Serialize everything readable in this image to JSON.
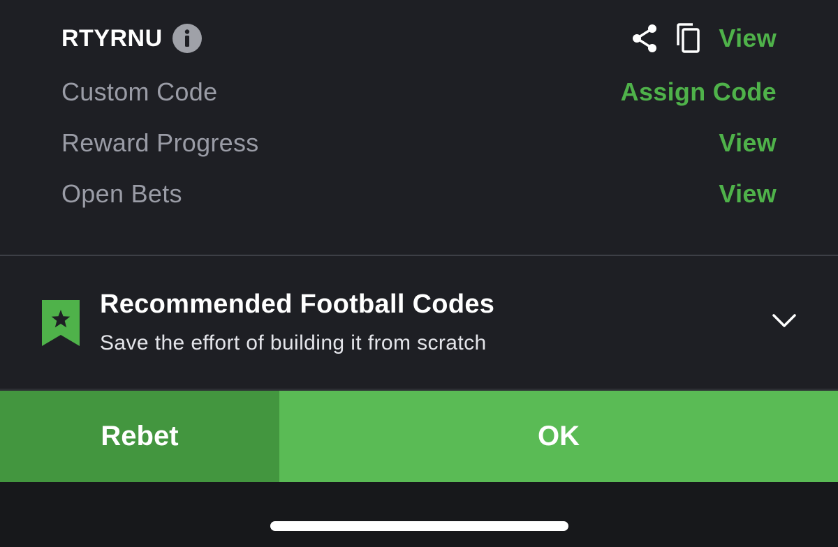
{
  "code_section": {
    "code": "RTYRNU",
    "info_icon": "info-icon",
    "share_icon": "share-icon",
    "copy_icon": "copy-icon",
    "view_label": "View"
  },
  "rows": [
    {
      "label": "Custom Code",
      "action": "Assign Code"
    },
    {
      "label": "Reward Progress",
      "action": "View"
    },
    {
      "label": "Open Bets",
      "action": "View"
    }
  ],
  "recommended": {
    "title": "Recommended Football Codes",
    "subtitle": "Save the effort of building it from scratch",
    "icon": "bookmark-star-icon",
    "toggle_icon": "chevron-down-icon"
  },
  "buttons": {
    "rebet_label": "Rebet",
    "ok_label": "OK"
  },
  "colors": {
    "background": "#1e1f24",
    "accent_green": "#4fb24a",
    "rebet_green": "#43963f",
    "ok_green": "#5abb55",
    "muted_text": "#9a9ca6"
  }
}
